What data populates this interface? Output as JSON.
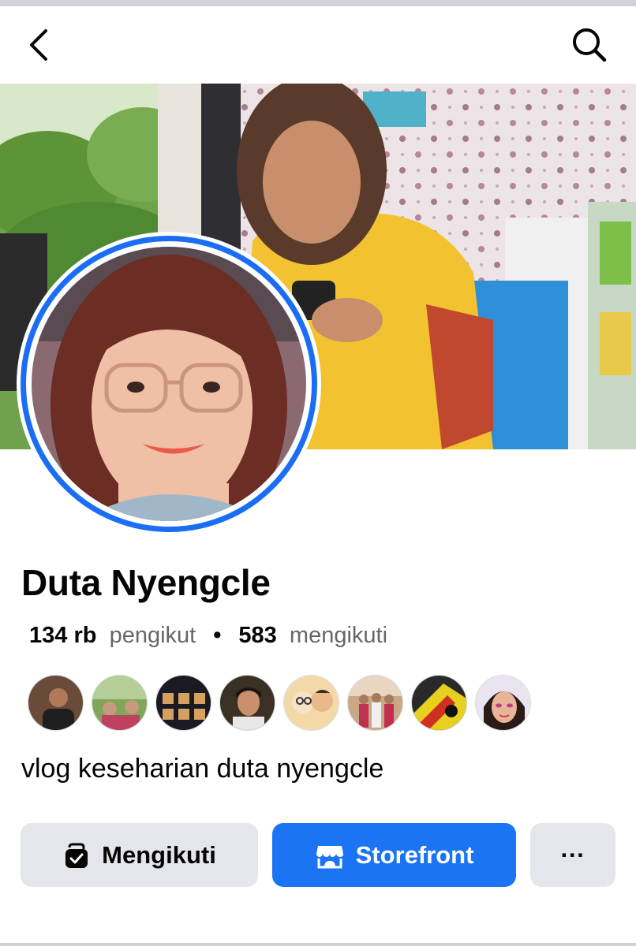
{
  "profile": {
    "name": "Duta Nyengcle",
    "followers_count": "134 rb",
    "followers_label": "pengikut",
    "following_count": "583",
    "following_label": "mengikuti",
    "bio": "vlog keseharian duta nyengcle"
  },
  "actions": {
    "follow_label": "Mengikuti",
    "storefront_label": "Storefront",
    "more_label": "···"
  },
  "colors": {
    "accent": "#1b74f3",
    "avatar_ring": "#1b6ef3",
    "secondary_button": "#e4e6eb",
    "muted_text": "#65676b"
  },
  "icons": {
    "back": "chevron-left-icon",
    "search": "search-icon",
    "follow": "following-check-icon",
    "storefront": "storefront-icon"
  }
}
